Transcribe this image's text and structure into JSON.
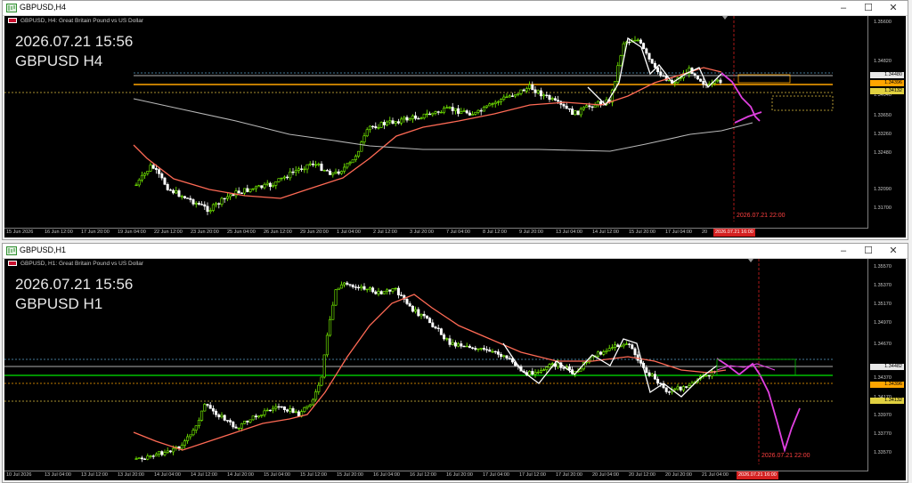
{
  "colors": {
    "bull": "#7cfc00",
    "bear": "#ffffff",
    "ema": "#ff6a55",
    "sma": "#b8b8b8",
    "zigzag": "#ffffff",
    "forecast": "#e040e0",
    "orange": "#ffa500",
    "green": "#00c000",
    "current_line": "#e8e8e8",
    "blue_dot": "#5aa0c8",
    "yellow_dot": "#e0c040",
    "red_vline": "#d42020"
  },
  "windows": [
    {
      "title": "GBPUSD,H4",
      "symbol_line": "GBPUSD, H4:  Great Britain Pound vs US Dollar",
      "overlay_time": "2026.07.21 15:56",
      "overlay_symbol": "GBPUSD H4",
      "forecast_label": "2026.07.21 22:00",
      "now_tag": "2026.07.21 16:00",
      "price_labels": [
        "1.35600",
        "1.34820",
        "1.34040",
        "1.33650",
        "1.33260",
        "1.32480",
        "1.32090",
        "1.31700"
      ],
      "price_tags": [
        {
          "text": "1.34480",
          "bg": "#e8e8e8"
        },
        {
          "text": "1.34396",
          "bg": "#ffa500"
        },
        {
          "text": "1.34132",
          "bg": "#e0d040"
        }
      ],
      "time_labels": [
        "15 Jun 2026",
        "16 Jun 12:00",
        "17 Jun 20:00",
        "19 Jun 04:00",
        "22 Jun 12:00",
        "23 Jun 20:00",
        "25 Jun 04:00",
        "26 Jun 12:00",
        "29 Jun 20:00",
        "1 Jul 04:00",
        "2 Jul 12:00",
        "3 Jul 20:00",
        "7 Jul 04:00",
        "8 Jul 12:00",
        "9 Jul 20:00",
        "13 Jul 04:00",
        "14 Jul 12:00",
        "15 Jul 20:00",
        "17 Jul 04:00",
        "20"
      ]
    },
    {
      "title": "GBPUSD,H1",
      "symbol_line": "GBPUSD, H1:  Great Britain Pound vs US Dollar",
      "overlay_time": "2026.07.21 15:56",
      "overlay_symbol": "GBPUSD H1",
      "forecast_label": "2026.07.21 22:00",
      "now_tag": "2026.07.21 16:00",
      "price_labels": [
        "1.35570",
        "1.35370",
        "1.35170",
        "1.34970",
        "1.34670",
        "1.34370",
        "1.34170",
        "1.33970",
        "1.33770",
        "1.33570"
      ],
      "price_tags": [
        {
          "text": "1.34482",
          "bg": "#e8e8e8"
        },
        {
          "text": "1.34396",
          "bg": "#ffa500"
        },
        {
          "text": "1.34132",
          "bg": "#e0d040"
        }
      ],
      "time_labels": [
        "10 Jul 2026",
        "13 Jul 04:00",
        "13 Jul 12:00",
        "13 Jul 20:00",
        "14 Jul 04:00",
        "14 Jul 12:00",
        "14 Jul 20:00",
        "15 Jul 04:00",
        "15 Jul 12:00",
        "15 Jul 20:00",
        "16 Jul 04:00",
        "16 Jul 12:00",
        "16 Jul 20:00",
        "17 Jul 04:00",
        "17 Jul 12:00",
        "17 Jul 20:00",
        "20 Jul 04:00",
        "20 Jul 12:00",
        "20 Jul 20:00",
        "21 Jul 04:00"
      ]
    }
  ]
}
